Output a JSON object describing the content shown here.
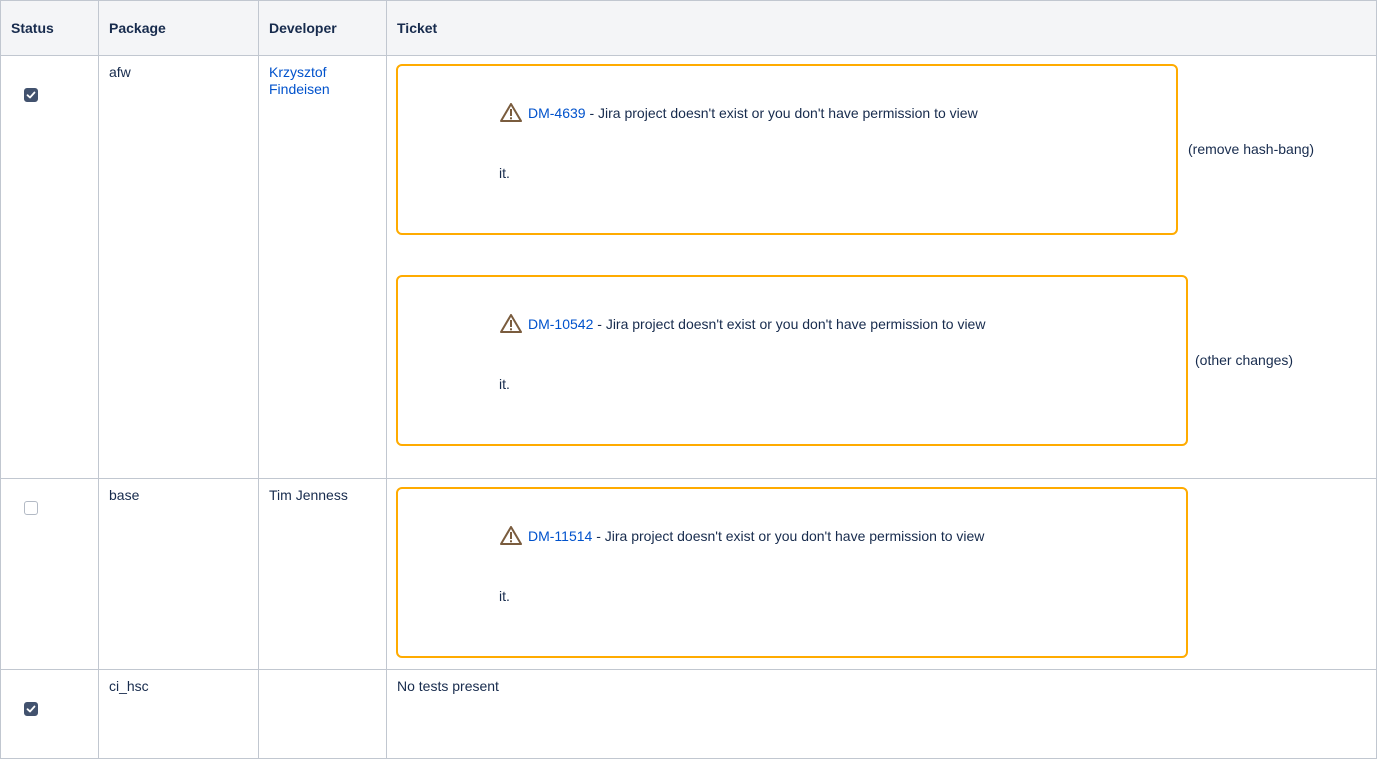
{
  "headers": {
    "status": "Status",
    "package": "Package",
    "developer": "Developer",
    "ticket": "Ticket"
  },
  "rows": [
    {
      "status_checked": true,
      "package": "afw",
      "developer": "Krzysztof Findeisen",
      "developer_is_link": true,
      "tickets": [
        {
          "key": "DM-4639",
          "message": "- Jira project doesn't exist or you don't have permission to view",
          "wrap": "it.",
          "note": "(remove hash-bang)"
        },
        {
          "key": "DM-10542",
          "message": "- Jira project doesn't exist or you don't have permission to view",
          "wrap": "it.",
          "note": "(other changes)"
        }
      ]
    },
    {
      "status_checked": false,
      "package": "base",
      "developer": "Tim Jenness",
      "developer_is_link": false,
      "tickets": [
        {
          "key": "DM-11514",
          "message": "- Jira project doesn't exist or you don't have permission to view",
          "wrap": "it.",
          "note": ""
        }
      ]
    },
    {
      "status_checked": true,
      "package": "ci_hsc",
      "developer": "",
      "developer_is_link": false,
      "ticket_text": "No tests present"
    }
  ],
  "icons": {
    "checked": "checkbox-checked-icon",
    "unchecked": "checkbox-unchecked-icon",
    "warning": "warning-triangle-icon"
  },
  "colors": {
    "link": "#0052cc",
    "jira_border": "#ffab00",
    "checkbox": "#42526e",
    "warning_icon": "#7a5c3e"
  }
}
